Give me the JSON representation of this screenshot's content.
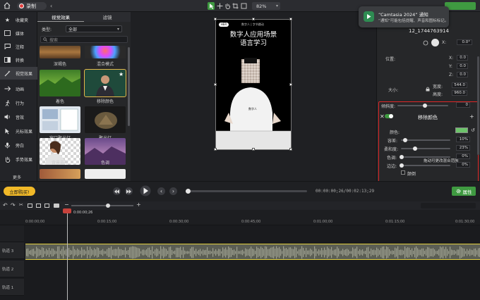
{
  "toolbar": {
    "record_label": "录制",
    "zoom_value": "82%"
  },
  "rail": {
    "items": [
      {
        "label": "收藏夹",
        "icon": "star-icon"
      },
      {
        "label": "媒体",
        "icon": "media-icon"
      },
      {
        "label": "注释",
        "icon": "annotation-icon"
      },
      {
        "label": "转换",
        "icon": "transition-icon"
      },
      {
        "label": "视觉效果",
        "icon": "wand-icon"
      },
      {
        "label": "动画",
        "icon": "animation-icon"
      },
      {
        "label": "行为",
        "icon": "run-icon"
      },
      {
        "label": "音效",
        "icon": "speaker-icon"
      },
      {
        "label": "光标效果",
        "icon": "cursor-icon"
      },
      {
        "label": "旁白",
        "icon": "mic-icon"
      },
      {
        "label": "手势效果",
        "icon": "hand-icon"
      }
    ],
    "more_label": "更多"
  },
  "effects": {
    "tabs": [
      "视觉效果",
      "滤镜"
    ],
    "category_label": "类型:",
    "category_value": "全部",
    "search_placeholder": "搜索",
    "thumbs": [
      {
        "label": "深褐色"
      },
      {
        "label": "混合模式"
      },
      {
        "label": "着色"
      },
      {
        "label": "移除颜色"
      },
      {
        "label": "窗口聚光灯"
      },
      {
        "label": "聚光灯"
      },
      {
        "label": "背景去除"
      },
      {
        "label": "色调"
      }
    ]
  },
  "video": {
    "tag": "HER",
    "header": "数字人 | 字节跳动",
    "title1": "数字人应用场景",
    "title2": "语言学习",
    "shirt_text": "数字人"
  },
  "notification": {
    "title": "“Camtasia 2024” 通知",
    "body": "“通知”可能包括提醒、声音和图标标记。"
  },
  "properties": {
    "clip_name": "12_1744763914",
    "rotation_value": "0.0°",
    "position_label": "位置:",
    "x_label": "X:",
    "x_value": "0.0",
    "y_label": "Y:",
    "y_value": "0.0",
    "z_label": "Z:",
    "z_value": "0.0",
    "size_label": "大小:",
    "width_label": "宽度:",
    "width_value": "544.0",
    "height_label": "高度:",
    "height_value": "960.0",
    "tilt_label": "倾斜度:",
    "tilt_value": "0",
    "effect_title": "移除颜色",
    "color_label": "颜色:",
    "tolerance_label": "容差:",
    "tolerance_value": "10%",
    "softness_label": "柔和度:",
    "softness_value": "23%",
    "hue_label": "色调:",
    "hue_value": "0%",
    "hue_hint": "拖动可更改混合范围",
    "edge_label": "边边:",
    "edge_value": "0%",
    "invert_label": "颠倒",
    "colors": {
      "key_color": "#6cc46a",
      "highlight": "#e02727"
    }
  },
  "playback": {
    "buy_label": "立即购买!",
    "timecode": "00:00:00;26/00:02:13;29",
    "props_label": "属性",
    "progress": 0.02
  },
  "timeline": {
    "playhead_time": "0:00:00;26",
    "ticks": [
      "0:00:00;00",
      "0:00:15;00",
      "0:00:30;00",
      "0:00:45;00",
      "0:01:00;00",
      "0:01:15;00",
      "0:01:30;00"
    ],
    "tracks": [
      "轨道 3",
      "轨道 2",
      "轨道 1"
    ]
  }
}
